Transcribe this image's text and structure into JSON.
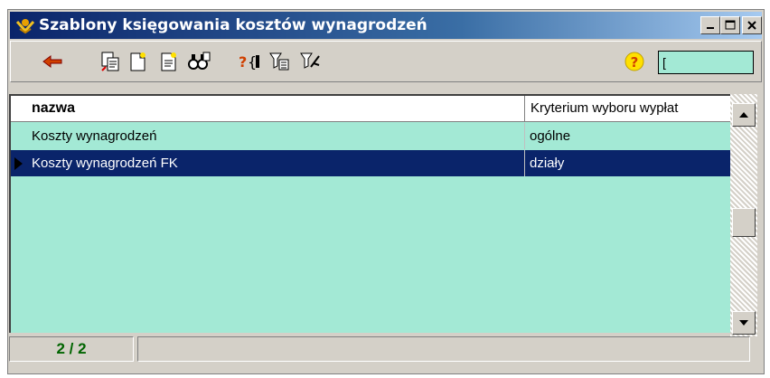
{
  "window": {
    "title": "Szablony księgowania kosztów wynagrodzeń",
    "controls": {
      "minimize": "_",
      "maximize": "□",
      "close": "X"
    }
  },
  "toolbar": {
    "tools": [
      "back-arrow-icon",
      "copy-record-icon",
      "new-record-icon",
      "edit-record-icon",
      "search-binoculars-icon",
      "query-icon",
      "filter-list-icon",
      "filter-icon"
    ],
    "help_label": "?",
    "filter_value": "["
  },
  "grid": {
    "columns": {
      "name": "nazwa",
      "kryterium": "Kryterium wyboru wypłat"
    },
    "rows": [
      {
        "name": "Koszty wynagrodzeń",
        "kryterium": "ogólne"
      },
      {
        "name": "Koszty wynagrodzeń FK",
        "kryterium": "działy"
      }
    ],
    "selected_row": 1
  },
  "status": {
    "record_count": "2 / 2"
  },
  "colors": {
    "grid_bg": "#a3e9d5",
    "selection": "#0a246a",
    "title_from": "#0a246a",
    "title_to": "#a6caf0"
  }
}
